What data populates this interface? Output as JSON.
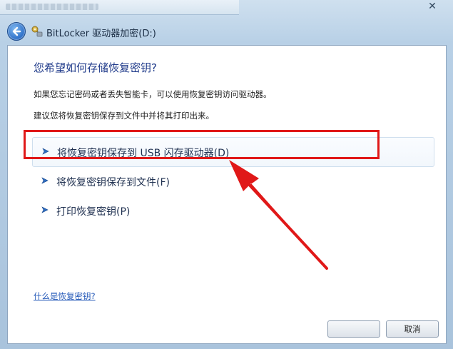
{
  "window": {
    "title": "BitLocker 驱动器加密(D:)",
    "close_glyph": "✕"
  },
  "content": {
    "heading": "您希望如何存储恢复密钥?",
    "paragraph1": "如果您忘记密码或者丢失智能卡，可以使用恢复密钥访问驱动器。",
    "paragraph2": "建议您将恢复密钥保存到文件中并将其打印出来。"
  },
  "options": [
    {
      "label": "将恢复密钥保存到 USB 闪存驱动器(D)",
      "icon": "arrow-right-icon"
    },
    {
      "label": "将恢复密钥保存到文件(F)",
      "icon": "arrow-right-icon"
    },
    {
      "label": "打印恢复密钥(P)",
      "icon": "arrow-right-icon"
    }
  ],
  "help_link": "什么是恢复密钥?",
  "buttons": {
    "next": "",
    "cancel": "取消"
  },
  "colors": {
    "heading": "#1f3a8a",
    "link": "#2358b8",
    "annotation": "#e01818"
  }
}
